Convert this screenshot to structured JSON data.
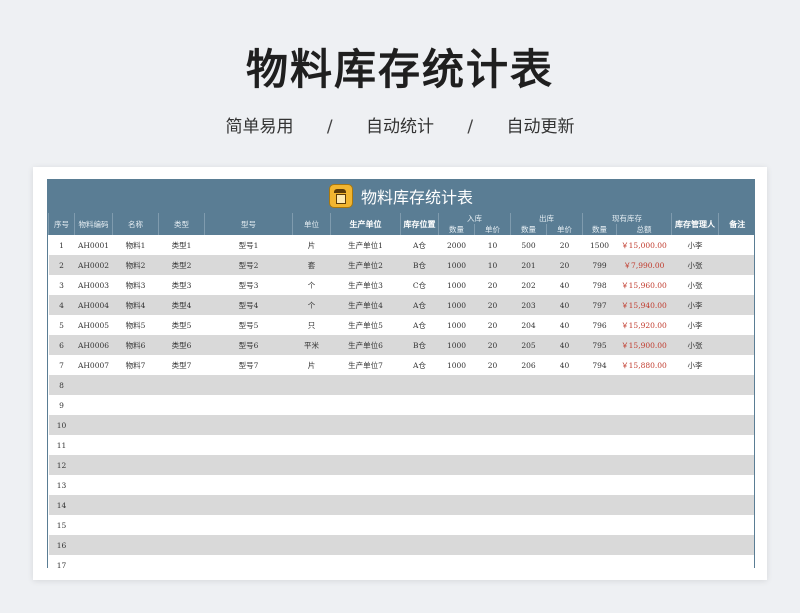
{
  "page": {
    "title": "物料库存统计表",
    "subtitle": [
      "简单易用",
      "自动统计",
      "自动更新"
    ],
    "separator": "/"
  },
  "sheet": {
    "banner_title": "物料库存统计表",
    "headers": {
      "seq": "序号",
      "code": "物料编码",
      "name": "名称",
      "type": "类型",
      "model": "型号",
      "unit": "单位",
      "producer": "生产单位",
      "location": "库存位置",
      "inbound": "入库",
      "outbound": "出库",
      "stock": "现有库存",
      "manager": "库存管理人",
      "remark": "备注",
      "qty": "数量",
      "price": "单价",
      "total": "总额"
    },
    "rows": [
      {
        "seq": "1",
        "code": "AH0001",
        "name": "物料1",
        "type": "类型1",
        "model": "型号1",
        "unit": "片",
        "producer": "生产单位1",
        "location": "A仓",
        "in_qty": "2000",
        "in_price": "10",
        "out_qty": "500",
        "out_price": "20",
        "stock_qty": "1500",
        "stock_total": "￥15,000.00",
        "manager": "小李",
        "remark": ""
      },
      {
        "seq": "2",
        "code": "AH0002",
        "name": "物料2",
        "type": "类型2",
        "model": "型号2",
        "unit": "套",
        "producer": "生产单位2",
        "location": "B仓",
        "in_qty": "1000",
        "in_price": "10",
        "out_qty": "201",
        "out_price": "20",
        "stock_qty": "799",
        "stock_total": "￥7,990.00",
        "manager": "小张",
        "remark": ""
      },
      {
        "seq": "3",
        "code": "AH0003",
        "name": "物料3",
        "type": "类型3",
        "model": "型号3",
        "unit": "个",
        "producer": "生产单位3",
        "location": "C仓",
        "in_qty": "1000",
        "in_price": "20",
        "out_qty": "202",
        "out_price": "40",
        "stock_qty": "798",
        "stock_total": "￥15,960.00",
        "manager": "小张",
        "remark": ""
      },
      {
        "seq": "4",
        "code": "AH0004",
        "name": "物料4",
        "type": "类型4",
        "model": "型号4",
        "unit": "个",
        "producer": "生产单位4",
        "location": "A仓",
        "in_qty": "1000",
        "in_price": "20",
        "out_qty": "203",
        "out_price": "40",
        "stock_qty": "797",
        "stock_total": "￥15,940.00",
        "manager": "小李",
        "remark": ""
      },
      {
        "seq": "5",
        "code": "AH0005",
        "name": "物料5",
        "type": "类型5",
        "model": "型号5",
        "unit": "只",
        "producer": "生产单位5",
        "location": "A仓",
        "in_qty": "1000",
        "in_price": "20",
        "out_qty": "204",
        "out_price": "40",
        "stock_qty": "796",
        "stock_total": "￥15,920.00",
        "manager": "小李",
        "remark": ""
      },
      {
        "seq": "6",
        "code": "AH0006",
        "name": "物料6",
        "type": "类型6",
        "model": "型号6",
        "unit": "平米",
        "producer": "生产单位6",
        "location": "B仓",
        "in_qty": "1000",
        "in_price": "20",
        "out_qty": "205",
        "out_price": "40",
        "stock_qty": "795",
        "stock_total": "￥15,900.00",
        "manager": "小张",
        "remark": ""
      },
      {
        "seq": "7",
        "code": "AH0007",
        "name": "物料7",
        "type": "类型7",
        "model": "型号7",
        "unit": "片",
        "producer": "生产单位7",
        "location": "A仓",
        "in_qty": "1000",
        "in_price": "20",
        "out_qty": "206",
        "out_price": "40",
        "stock_qty": "794",
        "stock_total": "￥15,880.00",
        "manager": "小李",
        "remark": ""
      },
      {
        "seq": "8"
      },
      {
        "seq": "9"
      },
      {
        "seq": "10"
      },
      {
        "seq": "11"
      },
      {
        "seq": "12"
      },
      {
        "seq": "13"
      },
      {
        "seq": "14"
      },
      {
        "seq": "15"
      },
      {
        "seq": "16"
      },
      {
        "seq": "17"
      }
    ]
  },
  "colors": {
    "header_bg": "#5a7d94",
    "stripe": "#d9d9d9",
    "money": "#c0392b",
    "logo": "#f1b530"
  },
  "icons": {
    "banner_logo": "warehouse-icon"
  }
}
